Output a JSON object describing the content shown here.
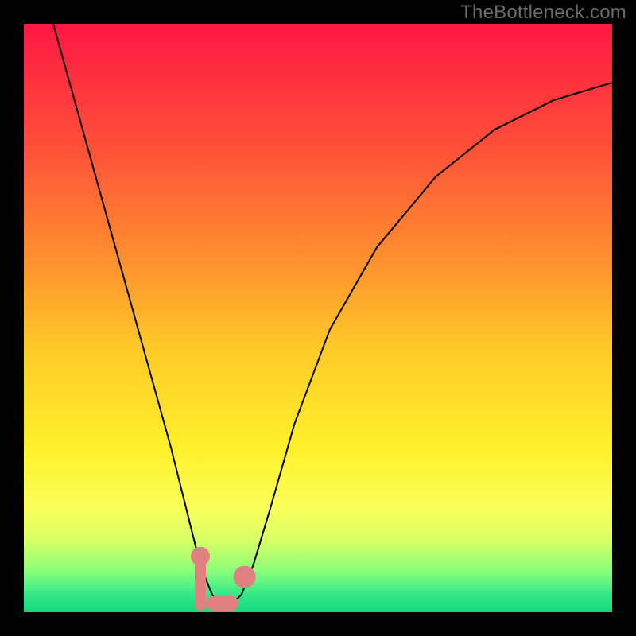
{
  "watermark": "TheBottleneck.com",
  "chart_data": {
    "type": "line",
    "title": "",
    "xlabel": "",
    "ylabel": "",
    "xlim": [
      0,
      100
    ],
    "ylim": [
      0,
      100
    ],
    "grid": false,
    "legend": false,
    "background_gradient": {
      "stops": [
        {
          "offset": 0.0,
          "color": "#ff1744"
        },
        {
          "offset": 0.2,
          "color": "#ff4d3a"
        },
        {
          "offset": 0.4,
          "color": "#ff8f2e"
        },
        {
          "offset": 0.55,
          "color": "#ffc927"
        },
        {
          "offset": 0.72,
          "color": "#fff02a"
        },
        {
          "offset": 0.82,
          "color": "#fbff59"
        },
        {
          "offset": 0.88,
          "color": "#d6ff66"
        },
        {
          "offset": 0.93,
          "color": "#8aff7a"
        },
        {
          "offset": 0.97,
          "color": "#34e889"
        },
        {
          "offset": 1.0,
          "color": "#17d87e"
        }
      ]
    },
    "series": [
      {
        "name": "bottleneck-curve",
        "color": "#000000",
        "stroke_width": 2,
        "x": [
          5,
          10,
          15,
          20,
          25,
          28,
          30,
          32,
          33.5,
          35,
          37,
          39,
          42,
          46,
          52,
          60,
          70,
          80,
          90,
          100
        ],
        "y_percent": [
          100,
          82,
          64,
          46,
          28,
          16,
          8,
          3,
          1,
          1,
          3,
          8,
          18,
          32,
          48,
          62,
          74,
          82,
          87,
          90
        ]
      }
    ],
    "markers": {
      "color": "#e08080",
      "points": [
        {
          "name": "left-dot",
          "x": 30.0,
          "y_percent": 9.5,
          "r": 12
        },
        {
          "name": "right-blob",
          "x": 37.5,
          "y_percent": 6.0,
          "r": 14
        }
      ],
      "bar": {
        "x1": 31.0,
        "x2": 36.5,
        "y_percent": 1.5,
        "thickness": 18
      }
    }
  }
}
